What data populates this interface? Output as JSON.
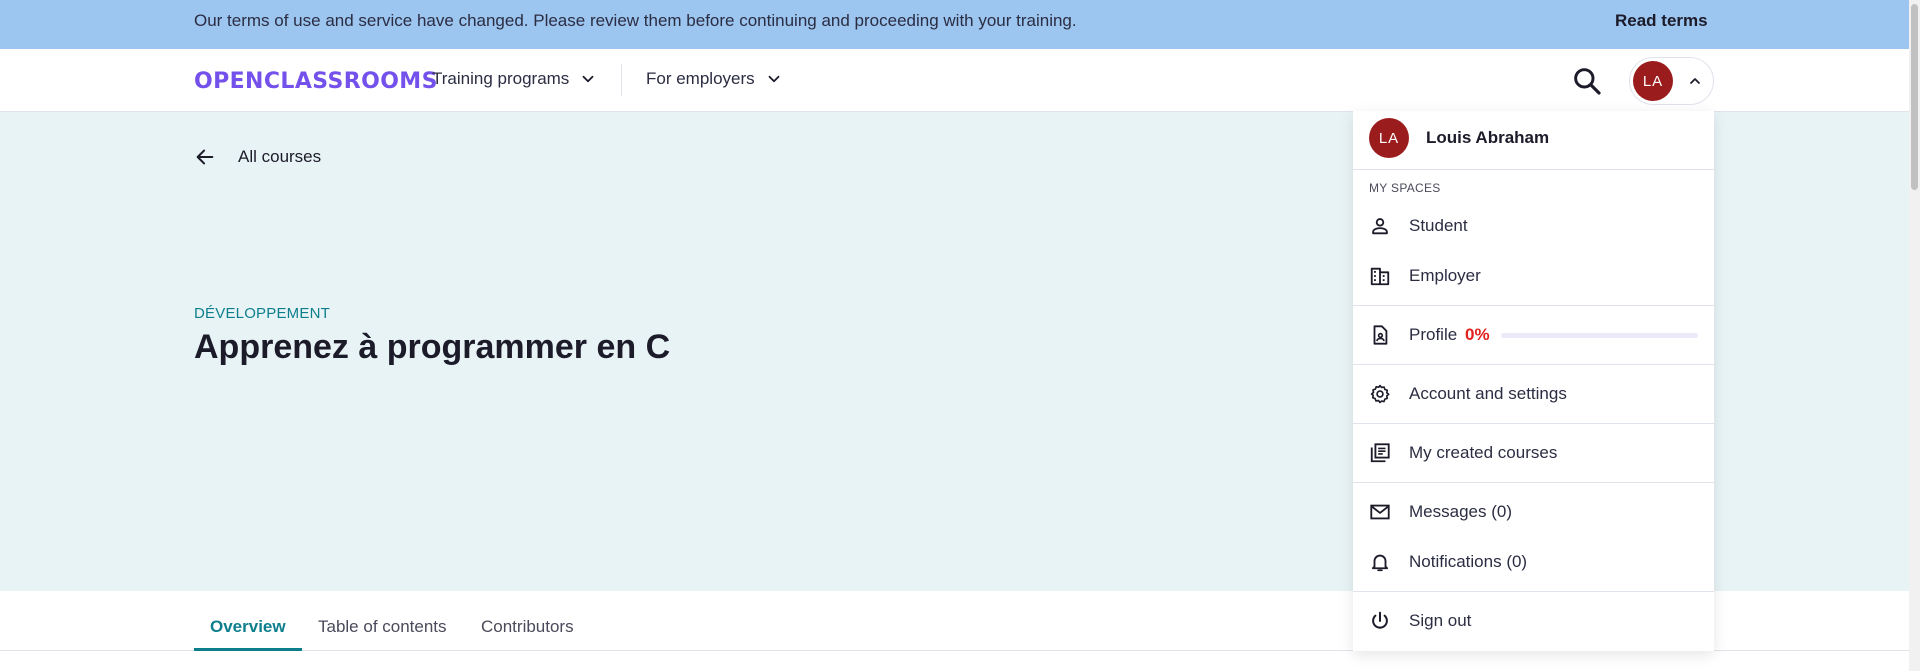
{
  "banner": {
    "message": "Our terms of use and service have changed. Please review them before continuing and proceeding with your training.",
    "link_label": "Read terms"
  },
  "header": {
    "logo_text": "OPENCLASSROOMS",
    "nav": [
      {
        "label": "Training programs"
      },
      {
        "label": "For employers"
      }
    ],
    "avatar_initials": "LA"
  },
  "hero": {
    "back_label": "All courses",
    "category": "DÉVELOPPEMENT",
    "title": "Apprenez à programmer en C"
  },
  "tabs": [
    {
      "label": "Overview",
      "active": true
    },
    {
      "label": "Table of contents",
      "active": false
    },
    {
      "label": "Contributors",
      "active": false
    }
  ],
  "user_menu": {
    "initials": "LA",
    "name": "Louis Abraham",
    "section_label": "MY SPACES",
    "spaces": [
      {
        "label": "Student",
        "icon": "person-icon"
      },
      {
        "label": "Employer",
        "icon": "building-icon"
      }
    ],
    "profile": {
      "label": "Profile",
      "completion_text": "0%",
      "completion": 0
    },
    "account_label": "Account and settings",
    "created_courses_label": "My created courses",
    "messages_label": "Messages (0)",
    "notifications_label": "Notifications (0)",
    "sign_out_label": "Sign out"
  },
  "colors": {
    "banner_bg": "#9cc5f0",
    "brand": "#7451eb",
    "accent_teal": "#0d7f8c",
    "hero_bg": "#e8f3f5",
    "avatar_bg": "#9b1c1c",
    "profile_percent": "#e0211d"
  }
}
